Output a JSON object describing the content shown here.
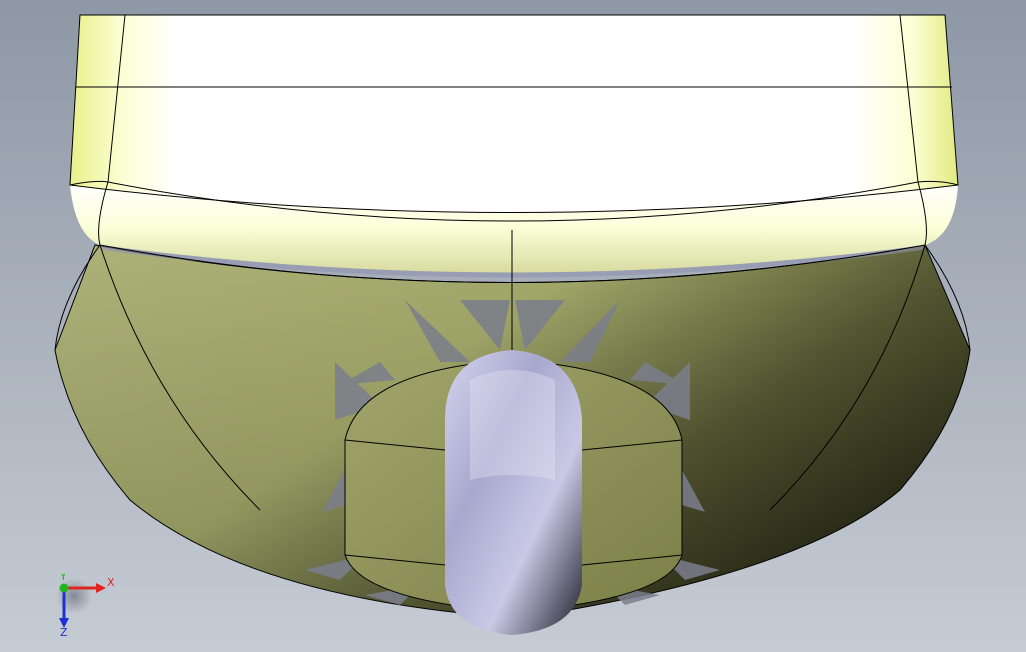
{
  "viewport": {
    "background_top": "#8f98a6",
    "background_bottom": "#c4cbd3",
    "body_color": "#a9ad6e",
    "highlight_color": "#ffffe0",
    "wheel_color": "#b6b6d6"
  },
  "triad": {
    "x_label": "X",
    "y_label": "Y",
    "z_label": "Z",
    "x_color": "#e0251f",
    "y_color": "#1fb51f",
    "z_color": "#1f2fd6"
  }
}
